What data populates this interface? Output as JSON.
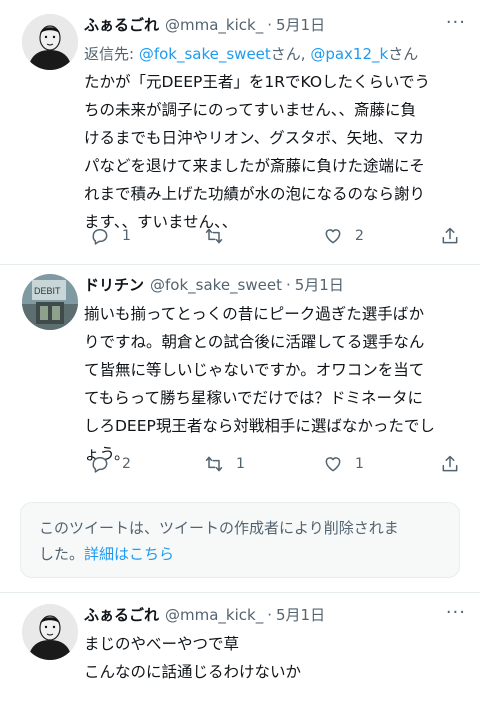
{
  "tweets": [
    {
      "name": "ふぁるごれ",
      "handle": "@mma_kick_",
      "dot": "·",
      "date": "5月1日",
      "reply_prefix": "返信先: ",
      "reply_mention_1": "@fok_sake_sweet",
      "reply_mid": "さん, ",
      "reply_mention_2": "@pax12_k",
      "reply_suffix": "さん",
      "lines": [
        "たかが「元DEEP王者」を1RでKOしたくらいでう",
        "ちの未来が調子にのってすいません、、斎藤に負",
        "けるまでも日沖やリオン、グスタボ、矢地、マカ",
        "パなどを退けて来ましたが斎藤に負けた途端にそ",
        "れまで積み上げた功績が水の泡になるのなら謝り",
        "ます、、すいません、、"
      ],
      "reply_count": "1",
      "retweet_count": "",
      "like_count": "2"
    },
    {
      "name": "ドリチン",
      "handle": "@fok_sake_sweet",
      "dot": "·",
      "date": "5月1日",
      "lines": [
        "揃いも揃ってとっくの昔にピーク過ぎた選手ばか",
        "りですね。朝倉との試合後に活躍してる選手なん",
        "て皆無に等しいじゃないですか。オワコンを当て",
        "てもらって勝ち星稼いでだけでは？ドミネータに",
        "しろDEEP現王者なら対戦相手に選ばなかったでし",
        "ょう。"
      ],
      "reply_count": "2",
      "retweet_count": "1",
      "like_count": "1"
    },
    {
      "name": "ふぁるごれ",
      "handle": "@mma_kick_",
      "dot": "·",
      "date": "5月1日",
      "lines": [
        "まじのやべーやつで草",
        "こんなのに話通じるわけないか"
      ]
    }
  ],
  "deleted_notice": {
    "line1": "このツイートは、ツイートの作成者により削除されま",
    "line2_prefix": "した。",
    "details_link": "詳細はこちら"
  },
  "avatar_sign_text": "DEBIT",
  "more_glyph": "···",
  "colors": {
    "text": "#0f1419",
    "secondary": "#536471",
    "link": "#1d9bf0",
    "divider": "#e7ecef",
    "notice_bg": "#f7f9f9"
  },
  "icons": {
    "reply": "reply-icon",
    "retweet": "retweet-icon",
    "like": "heart-icon",
    "share": "share-icon",
    "more": "more-icon"
  }
}
